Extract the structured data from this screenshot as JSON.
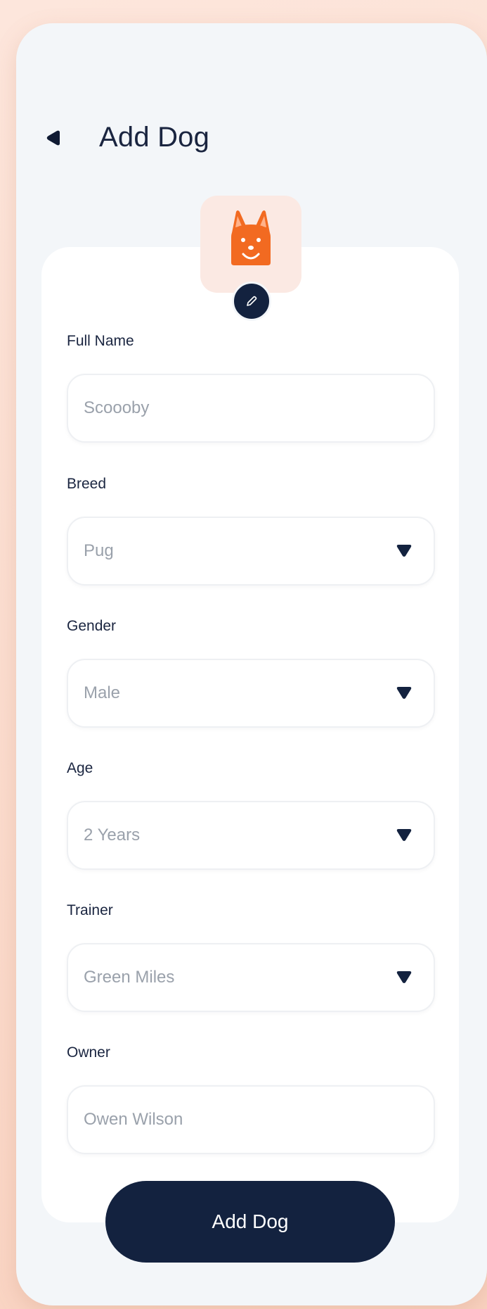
{
  "header": {
    "title": "Add Dog"
  },
  "avatar": {
    "icon": "dog-face-icon",
    "edit_icon": "pencil-icon",
    "accent": "#f26a21"
  },
  "form": {
    "fields": [
      {
        "label": "Full Name",
        "value": "Scoooby",
        "type": "text"
      },
      {
        "label": "Breed",
        "value": "Pug",
        "type": "select"
      },
      {
        "label": "Gender",
        "value": "Male",
        "type": "select"
      },
      {
        "label": "Age",
        "value": "2 Years",
        "type": "select"
      },
      {
        "label": "Trainer",
        "value": "Green Miles",
        "type": "select"
      },
      {
        "label": "Owner",
        "value": "Owen Wilson",
        "type": "text"
      }
    ]
  },
  "actions": {
    "submit_label": "Add Dog"
  },
  "colors": {
    "primary": "#13223f",
    "background": "#f3f6f9",
    "accent": "#f26a21"
  }
}
